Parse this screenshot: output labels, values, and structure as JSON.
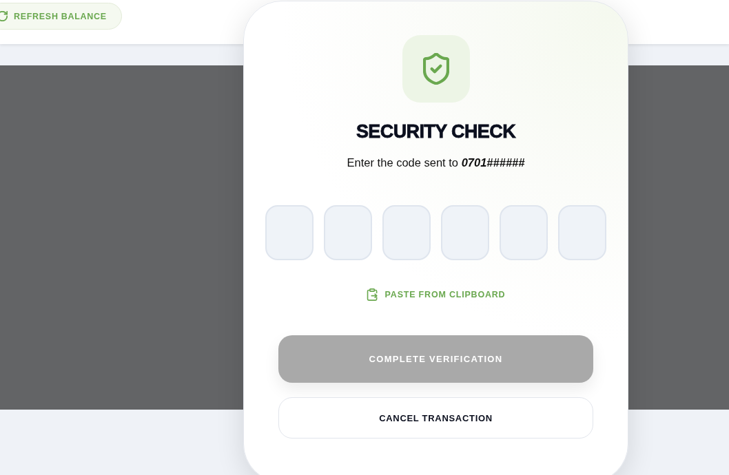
{
  "header": {
    "refresh_button": {
      "label": "REFRESH BALANCE"
    }
  },
  "dialog": {
    "title": "SECURITY CHECK",
    "message": {
      "text": "Enter the code sent to",
      "phone": "0701######"
    },
    "code_fields": [
      {
        "focused": false
      },
      {
        "focused": false
      },
      {
        "focused": false
      },
      {
        "focused": false
      },
      {
        "focused": false
      },
      {
        "focused": false
      }
    ],
    "paste_link": {
      "label": "PASTE FROM CLIPBOARD"
    },
    "buttons": [
      {
        "label": "COMPLETE VERIFICATION",
        "kind": "primary",
        "disabled": true
      },
      {
        "label": "CANCEL TRANSACTION",
        "kind": "secondary",
        "disabled": false
      }
    ]
  }
}
